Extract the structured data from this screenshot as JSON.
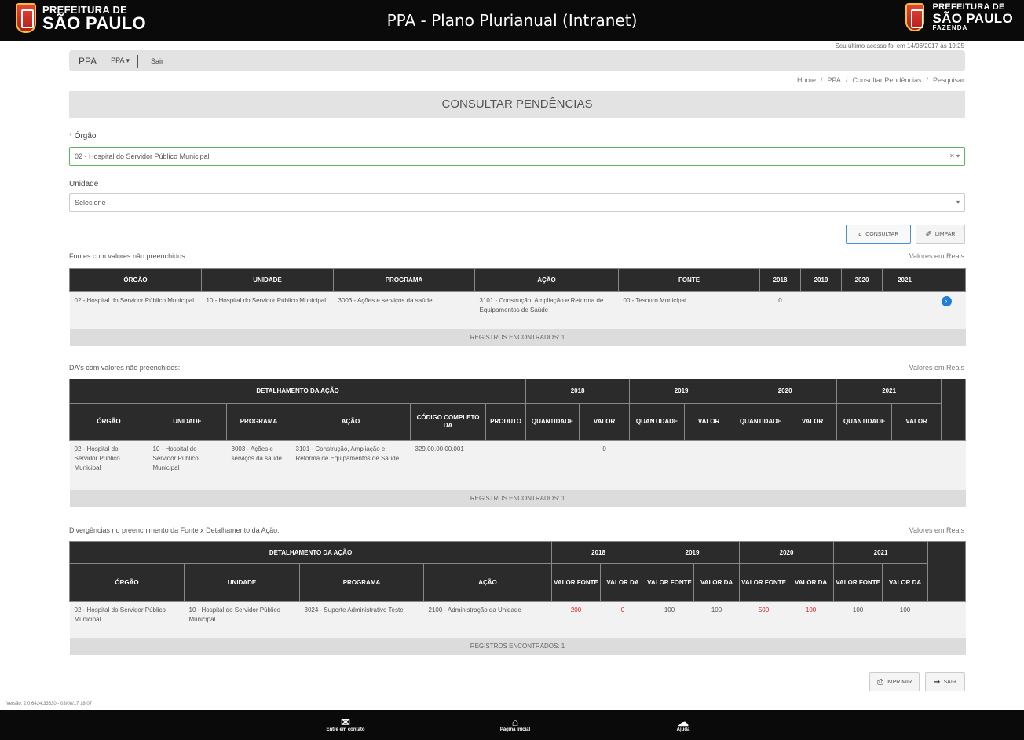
{
  "header": {
    "left_logo_line1": "PREFEITURA DE",
    "left_logo_line2": "SÃO PAULO",
    "title": "PPA - Plano Plurianual (Intranet)",
    "right_logo_line1": "PREFEITURA DE",
    "right_logo_line2": "SÃO PAULO",
    "right_logo_line3": "FAZENDA",
    "last_access": "Seu último acesso foi em 14/06/2017 às 19:25"
  },
  "nav": {
    "brand": "PPA",
    "dropdown": "PPA ▾",
    "exit": "Sair"
  },
  "breadcrumb": [
    "Home",
    "PPA",
    "Consultar Pendências",
    "Pesquisar"
  ],
  "page_title": "CONSULTAR PENDÊNCIAS",
  "form": {
    "orgao_label": "Órgão",
    "orgao_required": "*",
    "orgao_value": "02 - Hospital do Servidor Público Municipal",
    "unidade_label": "Unidade",
    "unidade_value": "Selecione",
    "consultar": "CONSULTAR",
    "limpar": "LIMPAR"
  },
  "values_note": "Valores em Reais",
  "table1": {
    "label": "Fontes com valores não preenchidos:",
    "headers": [
      "ÓRGÃO",
      "UNIDADE",
      "PROGRAMA",
      "AÇÃO",
      "FONTE",
      "2018",
      "2019",
      "2020",
      "2021"
    ],
    "row": [
      "02 - Hospital do Servidor Público Municipal",
      "10 - Hospital do Servidor Público Municipal",
      "3003 - Ações e serviços da saúde",
      "3101 - Construção, Ampliação e Reforma de Equipamentos de Saúde",
      "00 - Tesouro Municipal",
      "0",
      "",
      "",
      ""
    ],
    "footer": "REGISTROS ENCONTRADOS: 1"
  },
  "table2": {
    "label": "DA's com valores não preenchidos:",
    "group_header": "DETALHAMENTO DA AÇÃO",
    "years": [
      "2018",
      "2019",
      "2020",
      "2021"
    ],
    "headers": [
      "ÓRGÃO",
      "UNIDADE",
      "PROGRAMA",
      "AÇÃO",
      "CÓDIGO COMPLETO DA",
      "PRODUTO"
    ],
    "qty": "QUANTIDADE",
    "val": "VALOR",
    "row": [
      "02 - Hospital do Servidor Público Municipal",
      "10 - Hospital do Servidor Público Municipal",
      "3003 - Ações e serviços da saúde",
      "3101 - Construção, Ampliação e Reforma de Equipamentos de Saúde",
      "329.00.00.00.001",
      "",
      "",
      "0",
      "",
      "",
      "",
      "",
      "",
      ""
    ],
    "footer": "REGISTROS ENCONTRADOS: 1"
  },
  "table3": {
    "label": "Divergências no preenchimento da Fonte x Detalhamento da Ação:",
    "group_header": "DETALHAMENTO DA AÇÃO",
    "years": [
      "2018",
      "2019",
      "2020",
      "2021"
    ],
    "headers": [
      "ÓRGÃO",
      "UNIDADE",
      "PROGRAMA",
      "AÇÃO"
    ],
    "vf": "VALOR FONTE",
    "vd": "VALOR DA",
    "row": [
      "02 - Hospital do Servidor Público Municipal",
      "10 - Hospital do Servidor Público Municipal",
      "3024 - Suporte Administrativo Teste",
      "2100 - Administração da Unidade",
      "200",
      "0",
      "100",
      "100",
      "500",
      "100",
      "100",
      "100"
    ],
    "red_cells": [
      4,
      5,
      8,
      9
    ],
    "footer": "REGISTROS ENCONTRADOS: 1"
  },
  "actions": {
    "imprimir": "IMPRIMIR",
    "sair": "SAIR"
  },
  "version": "Versão: 2.0.6424.33630 - 03/08/17 18:07",
  "footer": {
    "contact": "Entre em contato",
    "home": "Página inicial",
    "help": "Ajuda"
  }
}
